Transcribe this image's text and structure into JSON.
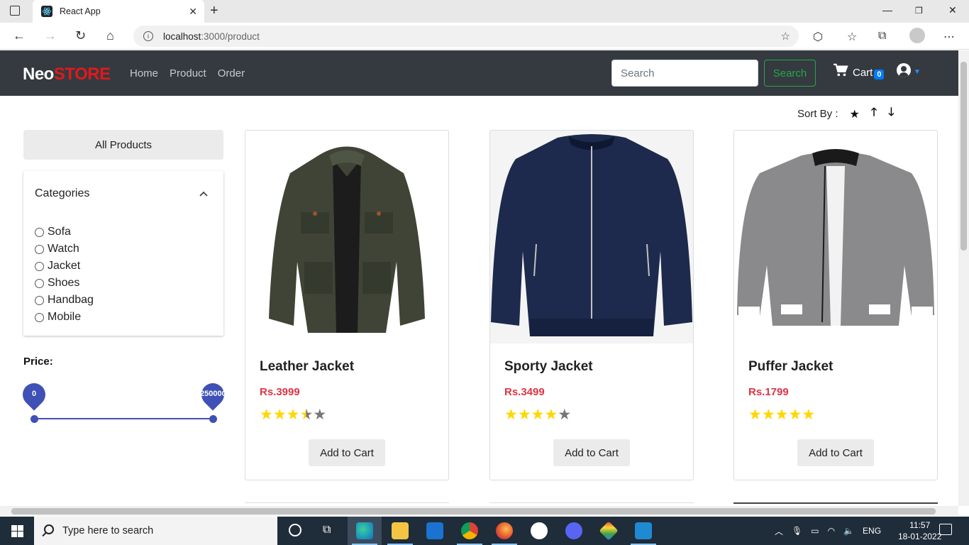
{
  "browser": {
    "tab_title": "React App",
    "url_host": "localhost",
    "url_path": ":3000/product"
  },
  "navbar": {
    "brand_neo": "Neo",
    "brand_store": "STORE",
    "links": [
      "Home",
      "Product",
      "Order"
    ],
    "search_placeholder": "Search",
    "search_button": "Search",
    "cart_label": "Cart",
    "cart_count": "0"
  },
  "sort": {
    "label": "Sort By :"
  },
  "sidebar": {
    "all_products": "All Products",
    "categories_title": "Categories",
    "categories": [
      "Sofa",
      "Watch",
      "Jacket",
      "Shoes",
      "Handbag",
      "Mobile"
    ],
    "price_label": "Price:",
    "price_min": "0",
    "price_max": "250000"
  },
  "products": [
    {
      "name": "Leather Jacket",
      "price": "Rs.3999",
      "rating": 3.5,
      "button": "Add to Cart"
    },
    {
      "name": "Sporty Jacket",
      "price": "Rs.3499",
      "rating": 4,
      "button": "Add to Cart"
    },
    {
      "name": "Puffer Jacket",
      "price": "Rs.1799",
      "rating": 5,
      "button": "Add to Cart"
    }
  ],
  "taskbar": {
    "search_placeholder": "Type here to search",
    "language": "ENG",
    "time": "11:57",
    "date": "18-01-2022"
  },
  "colors": {
    "navbar_bg": "#343a40",
    "brand_red": "#e0191c",
    "price_red": "#dc3545",
    "star_gold": "#ffd700",
    "slider_blue": "#3f51b5",
    "search_green": "#28a745"
  }
}
